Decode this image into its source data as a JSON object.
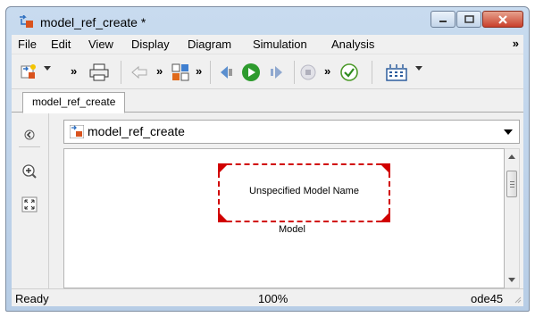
{
  "window": {
    "title": "model_ref_create *",
    "controls": [
      "minimize-icon",
      "maximize-icon",
      "close-icon"
    ]
  },
  "menu": {
    "items": [
      "File",
      "Edit",
      "View",
      "Display",
      "Diagram",
      "Simulation",
      "Analysis"
    ],
    "overflow": "»"
  },
  "toolbar": {
    "buttons": [
      "new-model-icon",
      "print-icon",
      "back-arrow-icon",
      "library-browser-icon",
      "step-back-icon",
      "run-icon",
      "step-forward-icon",
      "stop-icon",
      "model-advisor-check-icon",
      "build-icon"
    ],
    "overflow": "»"
  },
  "tabs": [
    {
      "label": "model_ref_create",
      "active": true
    }
  ],
  "address": {
    "path": "model_ref_create"
  },
  "canvas": {
    "block": {
      "label": "Unspecified Model Name",
      "name": "Model",
      "border_color": "#d10000"
    }
  },
  "status": {
    "left": "Ready",
    "zoom": "100%",
    "solver": "ode45"
  },
  "colors": {
    "accent": "#d10000",
    "run_green": "#2e9b2e"
  }
}
